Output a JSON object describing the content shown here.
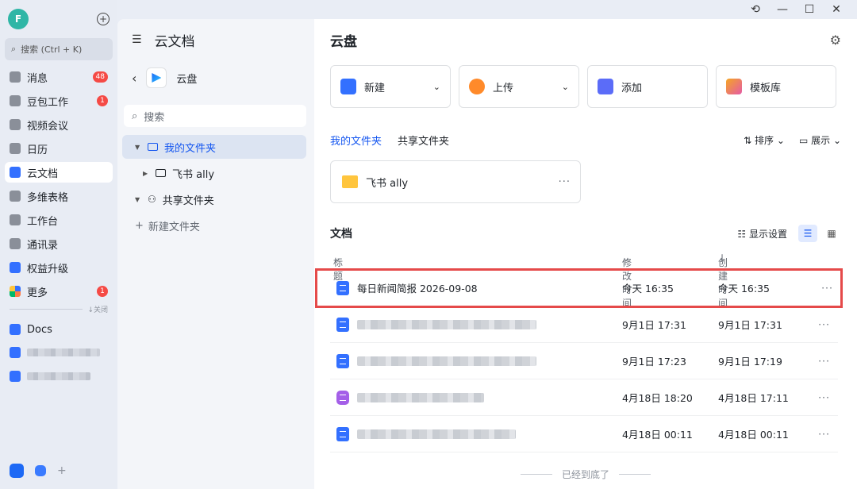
{
  "window": {
    "history_icon": "history-icon",
    "minimize": "—",
    "maximize": "☐",
    "close": "✕"
  },
  "user": {
    "avatar_letter": "F"
  },
  "nav": {
    "search_placeholder": "搜索 (Ctrl + K)",
    "items": [
      {
        "label": "消息",
        "badge": "48"
      },
      {
        "label": "豆包工作",
        "badge": "1"
      },
      {
        "label": "视频会议"
      },
      {
        "label": "日历"
      },
      {
        "label": "云文档"
      },
      {
        "label": "多维表格"
      },
      {
        "label": "工作台"
      },
      {
        "label": "通讯录"
      },
      {
        "label": "权益升级"
      },
      {
        "label": "更多",
        "badge": "1"
      }
    ],
    "close_label": "↓关闭",
    "pinned": [
      {
        "label": "Docs"
      }
    ]
  },
  "mid": {
    "title": "云文档",
    "space_name": "云盘",
    "search_placeholder": "搜索",
    "tree": {
      "my_folder": "我的文件夹",
      "child_folder": "飞书 ally",
      "shared_folder": "共享文件夹"
    },
    "new_folder": "新建文件夹"
  },
  "main": {
    "title": "云盘",
    "cards": [
      {
        "label": "新建",
        "color": "#3370ff"
      },
      {
        "label": "上传",
        "color": "#ff8a2a"
      },
      {
        "label": "添加",
        "color": "#5b6cf8"
      },
      {
        "label": "模板库",
        "color": "#f5a623"
      }
    ],
    "tabs": {
      "mine": "我的文件夹",
      "shared": "共享文件夹"
    },
    "sort_label": "排序",
    "show_label": "展示",
    "folder_name": "飞书 ally",
    "docs_title": "文档",
    "display_settings": "显示设置",
    "columns": {
      "title": "标题",
      "modified": "修改时间",
      "created": "创建时间"
    },
    "rows": [
      {
        "title": "每日新闻简报 2026-09-08",
        "modified": "今天 16:35",
        "created": "今天 16:35"
      },
      {
        "title": "",
        "modified": "9月1日 17:31",
        "created": "9月1日 17:31"
      },
      {
        "title": "",
        "modified": "9月1日 17:23",
        "created": "9月1日 17:19"
      },
      {
        "title": "",
        "modified": "4月18日 18:20",
        "created": "4月18日 17:11"
      },
      {
        "title": "",
        "modified": "4月18日 00:11",
        "created": "4月18日 00:11"
      }
    ],
    "footer": "已经到底了"
  }
}
